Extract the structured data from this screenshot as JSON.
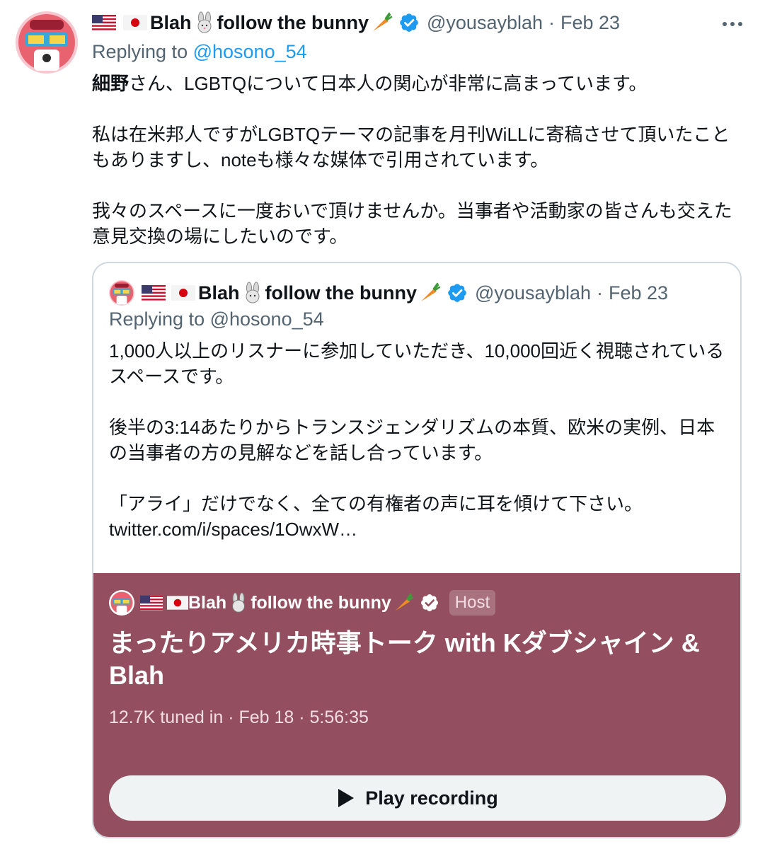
{
  "tweet": {
    "author_name": "Blah",
    "author_name_suffix": "follow the bunny",
    "handle": "@yousayblah",
    "separator": "·",
    "date": "Feb 23",
    "replying_prefix": "Replying to ",
    "replying_to": "@hosono_54",
    "text_bold": "細野",
    "text": "さん、LGBTQについて日本人の関心が非常に高まっています。\n\n私は在米邦人ですがLGBTQテーマの記事を月刊WiLLに寄稿させて頂いたこともありますし、noteも様々な媒体で引用されています。\n\n我々のスペースに一度おいで頂けませんか。当事者や活動家の皆さんも交えた意見交換の場にしたいのです。"
  },
  "quote": {
    "author_name": "Blah",
    "author_name_suffix": "follow the bunny",
    "handle": "@yousayblah",
    "separator": "·",
    "date": "Feb 23",
    "replying_prefix": "Replying to ",
    "replying_to": "@hosono_54",
    "text": "1,000人以上のリスナーに参加していただき、10,000回近く視聴されているスペースです。\n\n後半の3:14あたりからトランスジェンダリズムの本質、欧米の実例、日本の当事者の方の見解などを話し合っています。\n\n「アライ」だけでなく、全ての有権者の声に耳を傾けて下さい。\ntwitter.com/i/spaces/1OwxW…"
  },
  "space": {
    "host_name": "Blah",
    "host_name_suffix": "follow the bunny",
    "host_badge": "Host",
    "title": "まったりアメリカ時事トーク with Kダブシャイン & Blah",
    "meta": "12.7K tuned in · Feb 18 · 5:56:35",
    "play_label": "Play recording",
    "card_color": "#934f5f"
  },
  "icons": {
    "flags": [
      "us-flag-icon",
      "japan-flag-icon"
    ],
    "rabbit": "rabbit-icon",
    "carrot": "carrot-icon",
    "verified": "verified-badge-icon",
    "more": "more-options-icon",
    "play": "play-icon"
  },
  "colors": {
    "link": "#1d9bf0",
    "secondary_text": "#536471",
    "verified": "#1d9bf0"
  }
}
